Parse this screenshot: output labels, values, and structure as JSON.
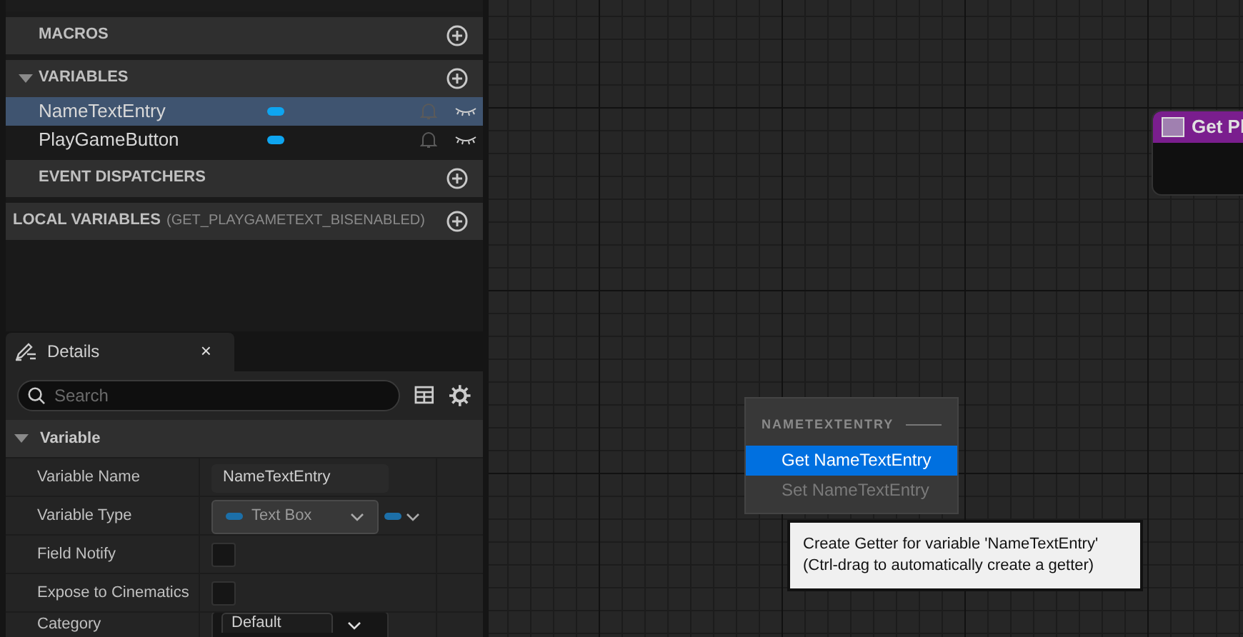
{
  "my_blueprint": {
    "sections": [
      {
        "label": "MACROS",
        "expanded": false
      },
      {
        "label": "VARIABLES",
        "expanded": true,
        "items": [
          {
            "name": "NameTextEntry",
            "color": "#0ea5f0",
            "selected": true
          },
          {
            "name": "PlayGameButton",
            "color": "#0ea5f0",
            "selected": false
          }
        ]
      },
      {
        "label": "EVENT DISPATCHERS",
        "expanded": false
      },
      {
        "label": "LOCAL VARIABLES",
        "suffix": "(GET_PLAYGAMETEXT_BISENABLED)",
        "expanded": false
      }
    ]
  },
  "details": {
    "tab": "Details",
    "close": "×",
    "search": {
      "placeholder": "Search"
    },
    "category": {
      "label": "Variable",
      "expanded": true
    },
    "rows": [
      {
        "kind": "text",
        "label": "Variable Name",
        "value": "NameTextEntry"
      },
      {
        "kind": "type",
        "label": "Variable Type",
        "value": "Text Box",
        "color": "#1c6fa8"
      },
      {
        "kind": "checkbox",
        "label": "Field Notify",
        "checked": false
      },
      {
        "kind": "checkbox",
        "label": "Expose to Cinematics",
        "checked": false
      },
      {
        "kind": "combo",
        "label": "Category",
        "value": "Default"
      }
    ]
  },
  "graph": {
    "node": {
      "title": "Get Pl"
    },
    "context_menu": {
      "heading": "NAMETEXTENTRY",
      "items": [
        {
          "label": "Get NameTextEntry",
          "selected": true
        },
        {
          "label": "Set NameTextEntry",
          "selected": false
        }
      ]
    },
    "tooltip": {
      "lines": [
        "Create Getter for variable 'NameTextEntry'",
        "(Ctrl-drag to automatically create a getter)"
      ]
    }
  }
}
